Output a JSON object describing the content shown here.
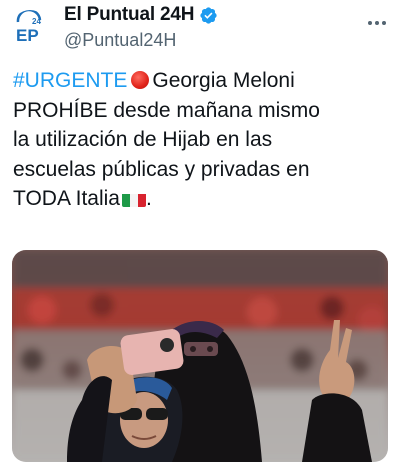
{
  "tweet": {
    "display_name": "El Puntual 24H",
    "handle": "@Puntual24H",
    "verified": true,
    "avatar_text": "24",
    "avatar_letters": "EP",
    "body": {
      "hashtag": "#URGENTE",
      "line1": "Georgia Meloni",
      "line2": "PROHÍBE desde mañana mismo",
      "line3": "la utilización de Hijab en las",
      "line4": "escuelas públicas y privadas en",
      "line5_text": "TODA Italia",
      "line5_end": "."
    },
    "icons": {
      "more": "more-options-icon",
      "verified": "verified-badge-icon",
      "urgent": "red-circle-icon",
      "flag": "italy-flag-icon"
    },
    "colors": {
      "hashtag": "#1d9bf0",
      "verified": "#1d9bf0",
      "text": "#0f1419",
      "secondary": "#536471"
    }
  }
}
